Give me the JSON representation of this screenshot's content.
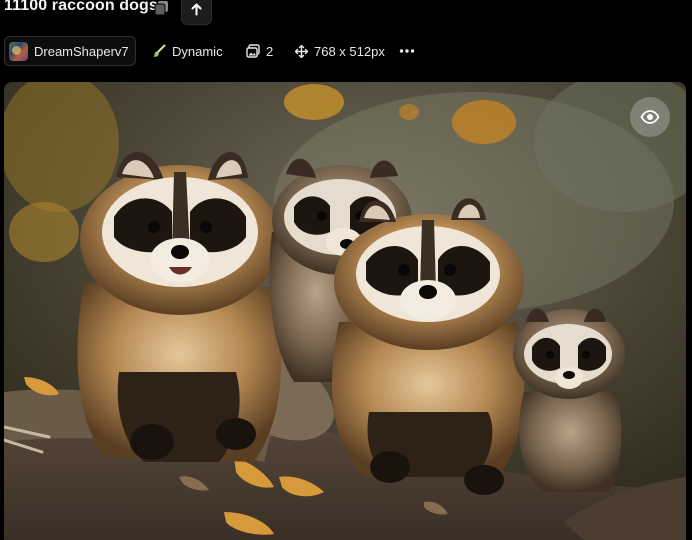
{
  "header": {
    "title": "11100 raccoon dogs",
    "copy_icon": "copy-icon",
    "up_icon": "arrow-up-icon"
  },
  "meta": {
    "model": "DreamShaperv7",
    "preset": "Dynamic",
    "image_count": "2",
    "dimensions": "768 x 512px",
    "more_icon": "more-horizontal-icon"
  },
  "image": {
    "subject": "raccoon-dogs-photo",
    "toggle_icon": "eye-icon"
  },
  "colors": {
    "background": "#000000",
    "chip_border": "#2f3036",
    "text": "#e8e8e8"
  }
}
